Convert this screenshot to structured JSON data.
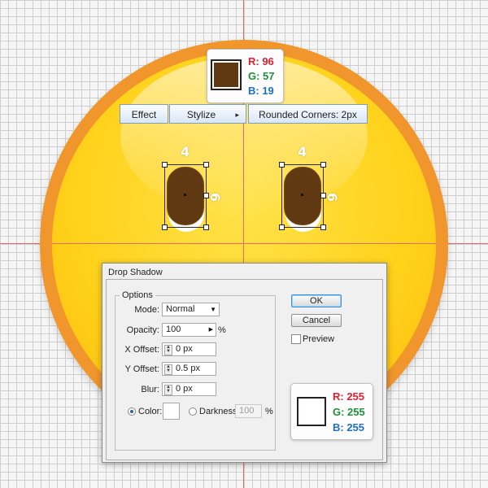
{
  "top_swatch": {
    "color": "#603913",
    "r": "R: 96",
    "g": "G: 57",
    "b": "B: 19"
  },
  "menu": {
    "effect": "Effect",
    "stylize": "Stylize",
    "stylize_arrow": "▸",
    "rounded": "Rounded Corners: 2px"
  },
  "eyes": {
    "width_label": "4",
    "height_label": "6"
  },
  "dialog": {
    "title": "Drop Shadow",
    "group": "Options",
    "mode_label": "Mode:",
    "mode_value": "Normal",
    "opacity_label": "Opacity:",
    "opacity_value": "100",
    "opacity_unit": "%",
    "xoffset_label": "X Offset:",
    "xoffset_value": "0 px",
    "yoffset_label": "Y Offset:",
    "yoffset_value": "0.5 px",
    "blur_label": "Blur:",
    "blur_value": "0 px",
    "color_label": "Color:",
    "darkness_label": "Darkness:",
    "darkness_value": "100",
    "darkness_unit": "%",
    "ok": "OK",
    "cancel": "Cancel",
    "preview": "Preview"
  },
  "bottom_swatch": {
    "color": "#ffffff",
    "r": "R: 255",
    "g": "G: 255",
    "b": "B: 255"
  }
}
